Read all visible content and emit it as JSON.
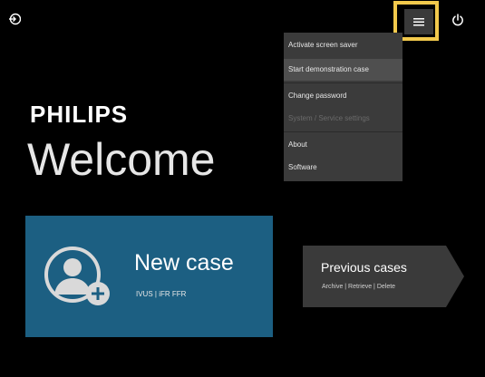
{
  "header": {
    "login_icon": "login-icon",
    "menu_icon": "hamburger-menu-icon",
    "power_icon": "power-icon"
  },
  "menu": {
    "items": [
      {
        "label": "Activate screen saver",
        "state": "normal"
      },
      {
        "label": "Start demonstration case",
        "state": "active"
      },
      {
        "label": "Change password",
        "state": "normal"
      },
      {
        "label": "System / Service settings",
        "state": "disabled"
      },
      {
        "label": "About",
        "state": "normal"
      },
      {
        "label": "Software",
        "state": "normal"
      }
    ]
  },
  "main": {
    "brand": "PHILIPS",
    "welcome": "Welcome"
  },
  "new_case": {
    "title": "New case",
    "subtitle": "IVUS | iFR FFR",
    "icon": "user-add-icon"
  },
  "previous_cases": {
    "title": "Previous cases",
    "subtitle": "Archive | Retrieve | Delete"
  },
  "colors": {
    "background": "#000000",
    "menu_bg": "#3b3b3b",
    "new_case_bg": "#1c5f82",
    "previous_bg": "#3a3a3a",
    "highlight": "#f2c94c"
  }
}
